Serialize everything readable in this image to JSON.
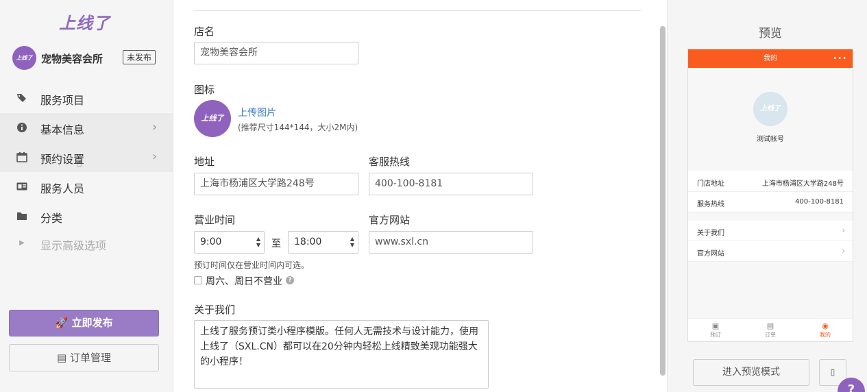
{
  "sidebar": {
    "logo": "上线了",
    "store": {
      "avatar_text": "上线了",
      "name": "宠物美容会所",
      "status": "未发布"
    },
    "items": [
      {
        "label": "服务项目",
        "icon": "tags-icon"
      },
      {
        "label": "基本信息",
        "icon": "info-icon",
        "chevron": true
      },
      {
        "label": "预约设置",
        "icon": "calendar-icon",
        "chevron": true
      },
      {
        "label": "服务人员",
        "icon": "id-card-icon"
      },
      {
        "label": "分类",
        "icon": "folder-icon"
      },
      {
        "label": "显示高级选项",
        "icon": "caret-right-icon"
      }
    ],
    "publish_label": "立即发布",
    "orders_label": "订单管理"
  },
  "form": {
    "store_name_label": "店名",
    "store_name_value": "宠物美容会所",
    "icon_label": "图标",
    "icon_avatar_text": "上线了",
    "upload_label": "上传图片",
    "upload_hint": "(推荐尺寸144*144，大小2M内)",
    "address_label": "地址",
    "address_value": "上海市杨浦区大学路248号",
    "hotline_label": "客服热线",
    "hotline_value": "400-100-8181",
    "hours_label": "营业时间",
    "hours_start": "9:00",
    "hours_to": "至",
    "hours_end": "18:00",
    "website_label": "官方网站",
    "website_value": "www.sxl.cn",
    "hours_hint": "预订时间仅在营业时间内可选。",
    "weekend_label": "周六、周日不营业",
    "about_label": "关于我们",
    "about_value": "上线了服务预订类小程序模版。任何人无需技术与设计能力，使用上线了（SXL.CN）都可以在20分钟内轻松上线精致美观功能强大的小程序！"
  },
  "preview": {
    "title": "预览",
    "phone": {
      "bar_title": "我的",
      "bar_dots": "•••",
      "avatar_text": "上线了",
      "account": "测试帐号",
      "rows": [
        {
          "k": "门店地址",
          "v": "上海市杨浦区大学路248号"
        },
        {
          "k": "服务热线",
          "v": "400-100-8181"
        },
        {
          "k": "关于我们"
        },
        {
          "k": "官方网站"
        }
      ],
      "tabs": [
        {
          "label": "预订"
        },
        {
          "label": "订单"
        },
        {
          "label": "我的"
        }
      ]
    },
    "preview_mode_label": "进入预览模式",
    "help_label": "?"
  },
  "colors": {
    "accent": "#8e62bd",
    "phone_bar": "#fa5b1e",
    "link": "#3a78c3"
  }
}
